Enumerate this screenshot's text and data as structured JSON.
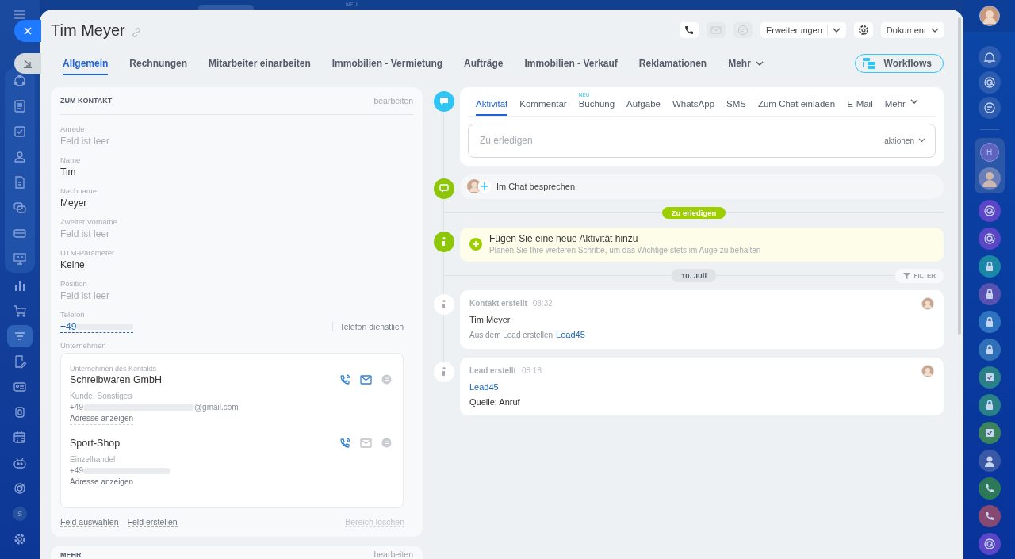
{
  "top_strip": {
    "badge": "NEU"
  },
  "left_sidebar": {
    "items": [
      {
        "kind": "sync",
        "selected": false
      },
      {
        "kind": "news",
        "selected": false
      },
      {
        "kind": "tasks",
        "selected": false
      },
      {
        "kind": "people",
        "selected": false
      },
      {
        "kind": "document",
        "selected": false
      },
      {
        "kind": "chat",
        "selected": false
      },
      {
        "kind": "card",
        "selected": false
      },
      {
        "kind": "presentation",
        "selected": false
      },
      {
        "kind": "chart",
        "selected": false
      },
      {
        "kind": "cart",
        "selected": false
      },
      {
        "kind": "funnel",
        "selected": true
      },
      {
        "kind": "edit",
        "selected": false
      },
      {
        "kind": "idcard",
        "selected": false
      },
      {
        "kind": "box",
        "selected": false
      },
      {
        "kind": "calendar",
        "selected": false
      },
      {
        "kind": "robot",
        "selected": false
      },
      {
        "kind": "target",
        "selected": false
      },
      {
        "kind": "initial",
        "text": "S",
        "selected": false
      },
      {
        "kind": "gear",
        "selected": false
      }
    ]
  },
  "title": "Tim Meyer",
  "toolbar": {
    "buttons": [
      {
        "kind": "phone",
        "disabled": false
      },
      {
        "kind": "mail",
        "disabled": true
      },
      {
        "kind": "chat",
        "disabled": true
      }
    ],
    "extensions": "Erweiterungen",
    "document": "Dokument"
  },
  "tabs": [
    {
      "label": "Allgemein",
      "selected": true
    },
    {
      "label": "Rechnungen",
      "selected": false
    },
    {
      "label": "Mitarbeiter einarbeiten",
      "selected": false
    },
    {
      "label": "Immobilien - Vermietung",
      "selected": false
    },
    {
      "label": "Aufträge",
      "selected": false
    },
    {
      "label": "Immobilien - Verkauf",
      "selected": false
    },
    {
      "label": "Reklamationen",
      "selected": false
    }
  ],
  "tabs_more": "Mehr",
  "workflows": "Workflows",
  "contact_card": {
    "title": "ZUM KONTAKT",
    "edit": "bearbeiten",
    "fields": [
      {
        "label": "Anrede",
        "value": "Feld ist leer",
        "empty": true
      },
      {
        "label": "Name",
        "value": "Tim",
        "empty": false
      },
      {
        "label": "Nachname",
        "value": "Meyer",
        "empty": false
      },
      {
        "label": "Zweiter Vorname",
        "value": "Feld ist leer",
        "empty": true
      },
      {
        "label": "UTM-Parameter",
        "value": "Keine",
        "empty": false
      },
      {
        "label": "Position",
        "value": "Feld ist leer",
        "empty": true
      }
    ],
    "phone": {
      "label": "Telefon",
      "value": "+49",
      "type": "Telefon dienstlich"
    },
    "companies_label": "Unternehmen",
    "companies": [
      {
        "caption": "Unternehmen des Kontakts",
        "name": "Schreibwaren GmbH",
        "type": "Kunde, Sonstiges",
        "phone": "+49",
        "email": "@gmail.com",
        "address": "Adresse anzeigen",
        "mail_enabled": true
      },
      {
        "name": "Sport-Shop",
        "type": "Einzelhandel",
        "phone": "+49",
        "address": "Adresse anzeigen",
        "mail_enabled": false
      }
    ],
    "footer_links": [
      "Feld auswählen",
      "Feld erstellen"
    ],
    "delete_link": "Bereich löschen"
  },
  "more_card": {
    "title": "MEHR",
    "edit": "bearbeiten"
  },
  "timeline": {
    "composer": {
      "tabs": [
        {
          "label": "Aktivität",
          "selected": true
        },
        {
          "label": "Kommentar",
          "selected": false
        },
        {
          "label": "Buchung",
          "selected": false,
          "badge": "NEU"
        },
        {
          "label": "Aufgabe",
          "selected": false
        },
        {
          "label": "WhatsApp",
          "selected": false
        },
        {
          "label": "SMS",
          "selected": false
        },
        {
          "label": "Zum Chat einladen",
          "selected": false
        },
        {
          "label": "E-Mail",
          "selected": false
        }
      ],
      "more": "Mehr",
      "placeholder": "Zu erledigen",
      "actions": "aktionen"
    },
    "chat_row": "Im Chat besprechen",
    "pending": "Zu erledigen",
    "add_activity": {
      "title": "Fügen Sie eine neue Aktivität hinzu",
      "hint": "Planen Sie Ihre weiteren Schritte, um das Wichtige stets im Auge zu behalten"
    },
    "date": "10. Juli",
    "filter": "FILTER",
    "events": [
      {
        "title": "Kontakt erstellt",
        "time": "08:32",
        "lines": [
          {
            "kind": "text",
            "text": "Tim Meyer"
          },
          {
            "kind": "source",
            "text": "Aus dem Lead erstellen",
            "link": "Lead45"
          }
        ]
      },
      {
        "title": "Lead erstellt",
        "time": "08:18",
        "lines": [
          {
            "kind": "link",
            "text": "Lead45"
          },
          {
            "kind": "text",
            "text": "Quelle: Anruf"
          }
        ]
      }
    ]
  },
  "right_sidebar": {
    "top": [
      {
        "kind": "avatar"
      },
      {
        "kind": "bell"
      },
      {
        "kind": "radar"
      },
      {
        "kind": "chat"
      }
    ],
    "pinned": [
      {
        "kind": "letter",
        "text": "H"
      },
      {
        "kind": "avatar"
      }
    ],
    "items": [
      {
        "kind": "radar",
        "color": "#5a46c6"
      },
      {
        "kind": "radar",
        "color": "#5a46c6"
      },
      {
        "kind": "lock",
        "color": "#1b87a6"
      },
      {
        "kind": "lock",
        "color": "#5652b2"
      },
      {
        "kind": "lock",
        "color": "#2e73c0"
      },
      {
        "kind": "lock",
        "color": "#3070b8"
      },
      {
        "kind": "check",
        "color": "#2a8089"
      },
      {
        "kind": "lock",
        "color": "#2a8089"
      },
      {
        "kind": "check",
        "color": "#3a835e"
      },
      {
        "kind": "avatar",
        "color": "#3a58a6"
      },
      {
        "kind": "phone",
        "color": "#2e785a"
      },
      {
        "kind": "phone",
        "color": "#864a72"
      },
      {
        "kind": "radar",
        "color": "#5a46c6"
      }
    ]
  }
}
